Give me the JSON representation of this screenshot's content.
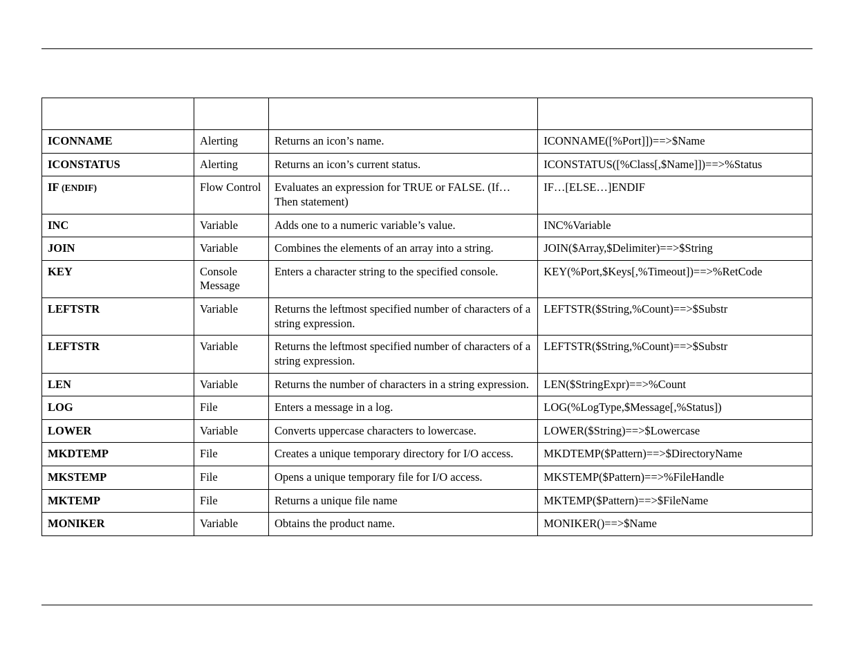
{
  "rows": [
    {
      "name": "ICONNAME",
      "paren": "",
      "category": "Alerting",
      "desc": "Returns an icon’s name.",
      "syntax": "ICONNAME([%Port]])==>$Name"
    },
    {
      "name": "ICONSTATUS",
      "paren": "",
      "category": "Alerting",
      "desc": "Returns an icon’s current status.",
      "syntax": "ICONSTATUS([%Class[,$Name]])==>%Status"
    },
    {
      "name": "IF ",
      "paren": "(ENDIF)",
      "category": "Flow Control",
      "desc": "Evaluates an expression for TRUE or FALSE. (If…Then statement)",
      "syntax": "IF…[ELSE…]ENDIF"
    },
    {
      "name": "INC",
      "paren": "",
      "category": "Variable",
      "desc": "Adds one to a numeric variable’s value.",
      "syntax": "INC%Variable"
    },
    {
      "name": "JOIN",
      "paren": "",
      "category": "Variable",
      "desc": "Combines the elements of an array into a string.",
      "syntax": "JOIN($Array,$Delimiter)==>$String"
    },
    {
      "name": "KEY",
      "paren": "",
      "category": "Console Message",
      "desc": "Enters a character string to the specified console.",
      "syntax": "KEY(%Port,$Keys[,%Timeout])==>%RetCode"
    },
    {
      "name": "LEFTSTR",
      "paren": "",
      "category": "Variable",
      "desc": "Returns the leftmost specified number of characters of a string expression.",
      "syntax": "LEFTSTR($String,%Count)==>$Substr"
    },
    {
      "name": "LEFTSTR",
      "paren": "",
      "category": "Variable",
      "desc": "Returns the leftmost specified number of characters of a string expression.",
      "syntax": "LEFTSTR($String,%Count)==>$Substr"
    },
    {
      "name": "LEN",
      "paren": "",
      "category": "Variable",
      "desc": "Returns the number of characters in a string expression.",
      "syntax": "LEN($StringExpr)==>%Count"
    },
    {
      "name": "LOG",
      "paren": "",
      "category": "File",
      "desc": "Enters a message in a log.",
      "syntax": "LOG(%LogType,$Message[,%Status])"
    },
    {
      "name": "LOWER",
      "paren": "",
      "category": "Variable",
      "desc": "Converts uppercase characters to lowercase.",
      "syntax": "LOWER($String)==>$Lowercase"
    },
    {
      "name": "MKDTEMP",
      "paren": "",
      "category": "File",
      "desc": "Creates a unique temporary directory for I/O access.",
      "syntax": "MKDTEMP($Pattern)==>$DirectoryName"
    },
    {
      "name": "MKSTEMP",
      "paren": "",
      "category": "File",
      "desc": "Opens a unique temporary file for I/O access.",
      "syntax": "MKSTEMP($Pattern)==>%FileHandle"
    },
    {
      "name": "MKTEMP",
      "paren": "",
      "category": "File",
      "desc": "Returns a unique file name",
      "syntax": "MKTEMP($Pattern)==>$FileName"
    },
    {
      "name": "MONIKER",
      "paren": "",
      "category": "Variable",
      "desc": "Obtains the product name.",
      "syntax": "MONIKER()==>$Name"
    }
  ]
}
